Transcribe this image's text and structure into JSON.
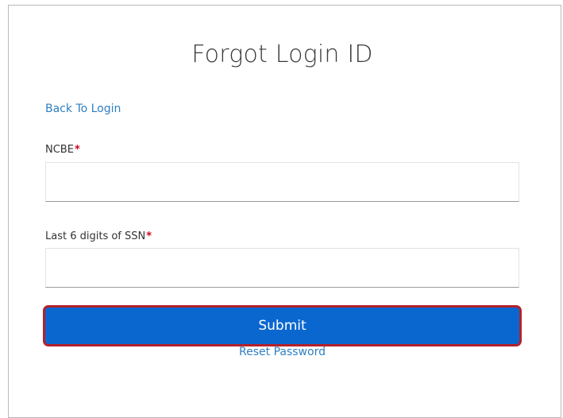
{
  "page": {
    "title": "Forgot Login ID"
  },
  "links": {
    "back_to_login": "Back To Login",
    "reset_password": "Reset Password"
  },
  "form": {
    "ncbe": {
      "label": "NCBE",
      "required_marker": "*",
      "value": ""
    },
    "ssn": {
      "label": "Last 6 digits of SSN",
      "required_marker": "*",
      "value": ""
    },
    "submit_label": "Submit"
  },
  "colors": {
    "link": "#2f7fc1",
    "submit_background": "#0b67d0",
    "submit_highlight_border": "#b3222a",
    "required_marker": "#d0021b"
  }
}
